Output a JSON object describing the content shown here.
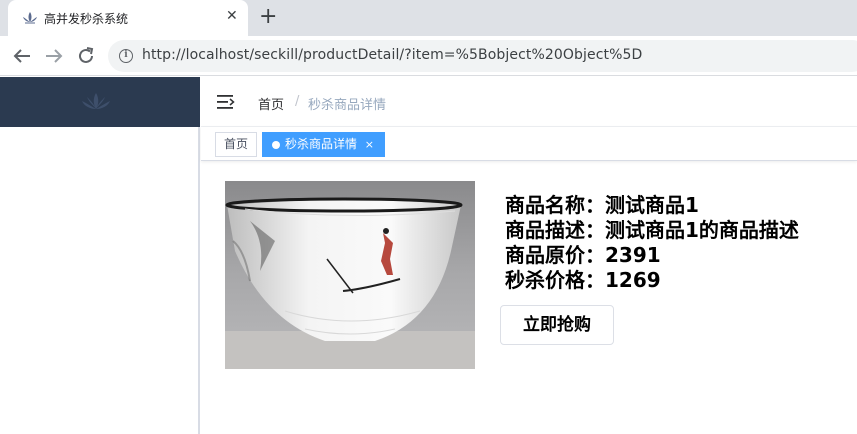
{
  "browser": {
    "tab_title": "高并发秒杀系统",
    "tab_close": "✕",
    "new_tab": "+",
    "url": "http://localhost/seckill/productDetail/?item=%5Bobject%20Object%5D"
  },
  "breadcrumb": {
    "home": "首页",
    "separator": "/",
    "current": "秒杀商品详情"
  },
  "tags": {
    "home": "首页",
    "active": "秒杀商品详情",
    "close": "×"
  },
  "product": {
    "name_label": "商品名称：",
    "name": "测试商品1",
    "desc_label": "商品描述：",
    "desc": "测试商品1的商品描述",
    "price_label": "商品原价：",
    "price": "2391",
    "seckill_label": "秒杀价格：",
    "seckill_price": "1269",
    "buy_label": "立即抢购"
  },
  "colors": {
    "sidebar_dark": "#2b3a50",
    "tag_active": "#409eff"
  }
}
